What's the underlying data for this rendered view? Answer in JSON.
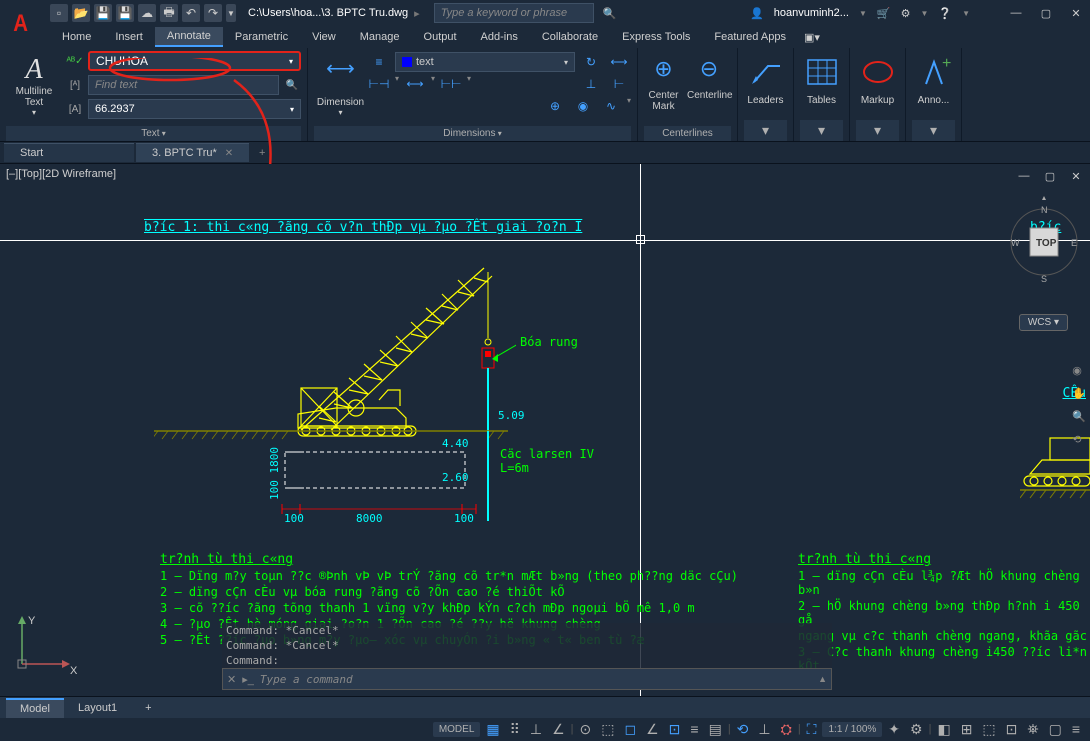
{
  "title_bar": {
    "path": "C:\\Users\\hoa...\\3. BPTC Tru.dwg",
    "search_placeholder": "Type a keyword or phrase",
    "user": "hoanvuminh2..."
  },
  "menu": {
    "items": [
      "Home",
      "Insert",
      "Annotate",
      "Parametric",
      "View",
      "Manage",
      "Output",
      "Add-ins",
      "Collaborate",
      "Express Tools",
      "Featured Apps"
    ],
    "active": "Annotate"
  },
  "ribbon": {
    "text_panel": {
      "mtext_label": "Multiline Text",
      "style_name": "CHUHOA",
      "find_placeholder": "Find text",
      "height_value": "66.2937",
      "title": "Text"
    },
    "dim_panel": {
      "label": "Dimension",
      "style_text": "text",
      "title": "Dimensions"
    },
    "center_panel": {
      "mark": "Center Mark",
      "line": "Centerline",
      "title": "Centerlines"
    },
    "leaders_panel": {
      "label": "Leaders"
    },
    "tables_panel": {
      "label": "Tables"
    },
    "markup_panel": {
      "label": "Markup"
    },
    "anno_panel": {
      "label": "Anno..."
    }
  },
  "file_tabs": {
    "tab1": "Start",
    "tab2": "3. BPTC Tru*"
  },
  "canvas": {
    "view_label": "[–][Top][2D Wireframe]",
    "title1": "b?íc 1: thi c«ng ?ãng cõ v?n thÐp vµ ?µo ?Êt giai ?o?n I",
    "title2": "b?íc",
    "boa_rung": "Bóa rung",
    "dim_509": "5.09",
    "dim_440": "4.40",
    "dim_260": "2.60",
    "dim_100a": "100",
    "dim_8000": "8000",
    "dim_100b": "100",
    "dim_1001800": "100 1800",
    "coc_larsen_1": "Cäc larsen IV",
    "coc_larsen_2": "L=6m",
    "cee": "CÊu",
    "viewcube_top": "TOP",
    "wcs": "WCS",
    "cube_n": "N",
    "cube_s": "S",
    "cube_e": "E",
    "cube_w": "W"
  },
  "steps_left": {
    "title": "tr?nh tù thi c«ng",
    "s1": "1 – Dïng m?y toµn ??c ®Þnh vÞ vÞ trÝ ?ãng cõ tr*n mÆt b»ng (theo ph??ng däc cÇu)",
    "s2": "2 – dïng cÇn cÈu vµ bóa rung ?ãng cõ ?Õn cao ?é thiÕt kÕ",
    "s3": "3 – cõ ??íc ?ãng tõng thanh 1 vïng v?y khÐp kÝn c?ch mĐp ngoµi bÖ mê 1,0 m",
    "s4": "4 – ?µo ?Êt hè móng giai ?o?n 1 ?Õn cao ?é ??y hë khung chèng",
    "s5": "5 – ?Êt ??íc ?µo b»ng m?y ?µo– xóc vµ chuyÓn ?i b»ng « t« ben tù ?æ"
  },
  "steps_right": {
    "title": "tr?nh tù thi c«ng",
    "s1": "1 – dïng cÇn cÈu l¾p ?Æt hÖ khung chèng b»n",
    "s2": "2 – hÖ khung chèng b»ng thÐp h?nh i 450 gå",
    "s3": "ngang vµ c?c thanh chèng ngang, khãa gãc",
    "s4": "3 – C?c thanh khung chèng i450 ??íc li*n kÕt"
  },
  "cmd": {
    "h1": "Command: *Cancel*",
    "h2": "Command: *Cancel*",
    "h3": "Command:",
    "placeholder": "Type a command"
  },
  "layout_tabs": {
    "t1": "Model",
    "t2": "Layout1"
  },
  "status": {
    "model": "MODEL",
    "scale": "1:1 / 100%"
  }
}
